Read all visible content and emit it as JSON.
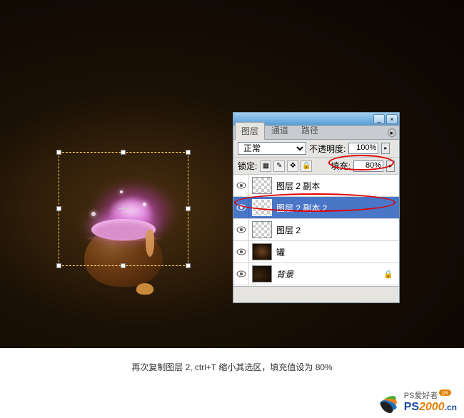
{
  "panel": {
    "tabs": {
      "layers": "图层",
      "channels": "通道",
      "paths": "路径"
    },
    "blend_mode": "正常",
    "opacity_label": "不透明度:",
    "opacity_value": "100%",
    "lock_label": "锁定:",
    "fill_label": "填充:",
    "fill_value": "80%",
    "win_min": "_",
    "win_close": "×",
    "opts_menu": "▸"
  },
  "layers": [
    {
      "name": "图层 2 副本",
      "selected": false,
      "thumb": "checker",
      "locked": false
    },
    {
      "name": "图层 2 副本 2",
      "selected": true,
      "thumb": "checker",
      "locked": false
    },
    {
      "name": "图层 2",
      "selected": false,
      "thumb": "checker",
      "locked": false
    },
    {
      "name": "罐",
      "selected": false,
      "thumb": "pot",
      "locked": false
    },
    {
      "name": "背景",
      "selected": false,
      "thumb": "bg",
      "locked": true,
      "italic": true
    }
  ],
  "caption": "再次复制图层 2, ctrl+T 缩小其选区，填充值设为 80%",
  "watermark": {
    "tag": "PS爱好者",
    "url_ps": "PS",
    "url_2000": "2000",
    "url_cn": ".cn",
    "badge": "ps"
  }
}
